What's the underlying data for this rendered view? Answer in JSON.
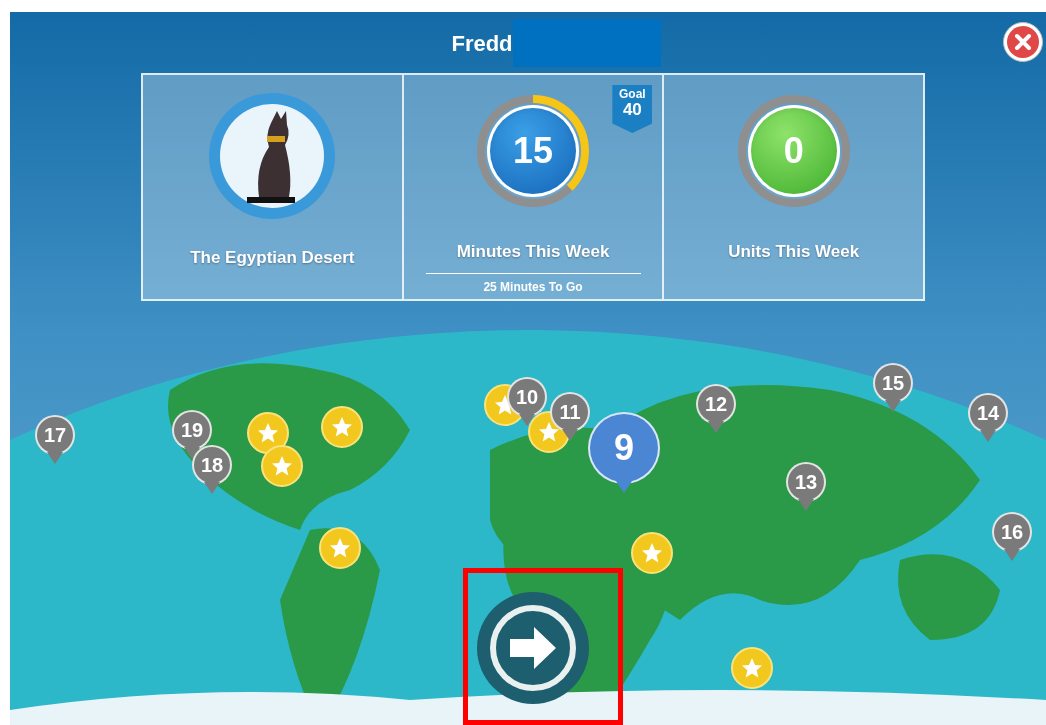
{
  "header": {
    "name": "Fredd"
  },
  "cards": [
    {
      "kind": "badge",
      "label": "The Egyptian Desert"
    },
    {
      "kind": "minutes",
      "value": "15",
      "label": "Minutes This Week",
      "goal_label": "Goal",
      "goal": "40",
      "level": 0.375,
      "note": "25 Minutes To Go"
    },
    {
      "kind": "units",
      "value": "0",
      "label": "Units This Week",
      "level": 0
    }
  ],
  "pins": [
    {
      "kind": "star"
    },
    {
      "kind": "star"
    },
    {
      "kind": "star"
    },
    {
      "kind": "star"
    },
    {
      "kind": "star"
    },
    {
      "kind": "star"
    },
    {
      "kind": "star"
    },
    {
      "kind": "star"
    },
    {
      "kind": "number",
      "label": "17",
      "selected": false
    },
    {
      "kind": "number",
      "label": "19",
      "selected": false
    },
    {
      "kind": "number",
      "label": "18",
      "selected": false
    },
    {
      "kind": "number",
      "label": "10",
      "selected": false
    },
    {
      "kind": "number",
      "label": "11",
      "selected": false
    },
    {
      "kind": "number",
      "label": "12",
      "selected": false
    },
    {
      "kind": "number",
      "label": "15",
      "selected": false
    },
    {
      "kind": "number",
      "label": "14",
      "selected": false
    },
    {
      "kind": "number",
      "label": "13",
      "selected": false
    },
    {
      "kind": "number",
      "label": "16",
      "selected": false
    },
    {
      "kind": "number",
      "label": "9",
      "selected": true
    }
  ]
}
